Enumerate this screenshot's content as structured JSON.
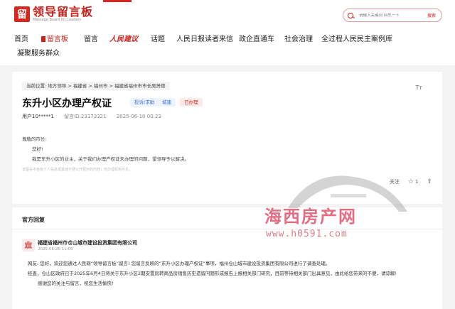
{
  "brand": {
    "logo_mark": "留",
    "name_cn": "领导留言板",
    "name_en": "Message Board for Leaders"
  },
  "search": {
    "placeholder": "请输入关键词 回车一下",
    "button": "搜索",
    "icon": "search-icon"
  },
  "nav": [
    "首页",
    "留言板",
    "留言",
    "人民建议",
    "话题",
    "人民日报读者来信",
    "政企直通车",
    "社会治理",
    "全过程人民民主案例库",
    "凝聚服务群众"
  ],
  "breadcrumb": "当前位置: 地方领导 > 福建省 > 福州市 > 福建省福州市市长吴贤德",
  "post": {
    "title": "东升小区办理产权证",
    "tags": [
      "投诉/求助",
      "城建",
      "已办理"
    ],
    "user": "用户10*****1",
    "msg_id": "留言ID:23173321",
    "date": "2025-06-10 00:23",
    "salutation": "尊敬的市长:",
    "greeting": "您好!",
    "content": "我是东升小区的业主，关于我们办理产权证未办理的问题，望领导予以解决。",
    "disclaimer": "该留言中含有个人信息或其他不便公开展示的内容，仅办理机构可见。"
  },
  "actions": {
    "follow": "关注",
    "likes": "1",
    "like_icon": "star-icon",
    "share_icon": "share-icon",
    "fontsize_icon": "Tт"
  },
  "reply": {
    "heading": "官方回复",
    "org": "福建省福州市仓山城市建设投资集团有限公司",
    "date": "2025-06-25 11:06",
    "p1": "网友: 您好，欢迎您通过人民网“领导留言板”留言! 您留言反映的“东升小区办理产权证”事项，福州仓山城市建设投资集团有限公司进行了调查处理。",
    "p2": "经查，仓山区政府已于2025年6月4日将关于东升小区2期安置房转商品房销售历史遗留问题形成报告上报相关部门研究，目前等待相关部门出具意见，由此给您带来的不便，请谅解!",
    "p3": "感谢您的关注与留言，祝您生活愉快!"
  },
  "watermark": {
    "cn": "海西房产网",
    "url": "www.h0591.com"
  }
}
